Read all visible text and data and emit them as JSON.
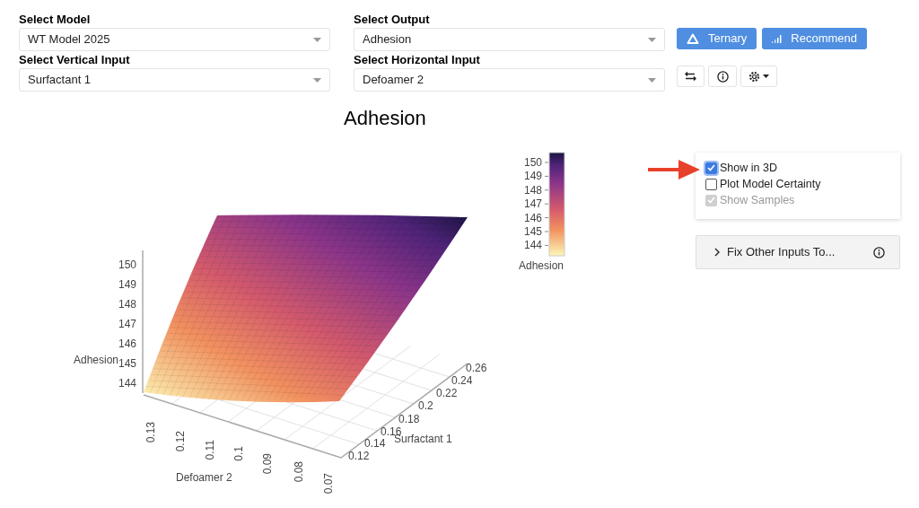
{
  "selects": [
    {
      "label": "Select Model",
      "value": "WT Model 2025"
    },
    {
      "label": "Select Output",
      "value": "Adhesion"
    },
    {
      "label": "Select Vertical Input",
      "value": "Surfactant 1"
    },
    {
      "label": "Select Horizontal Input",
      "value": "Defoamer 2"
    }
  ],
  "action_buttons": [
    {
      "label": "Ternary",
      "kind": "triangle"
    },
    {
      "label": "Recommend",
      "kind": "bars"
    }
  ],
  "tool_buttons": [
    {
      "kind": "swap"
    },
    {
      "kind": "info"
    },
    {
      "kind": "gear"
    }
  ],
  "plot": {
    "title": "Adhesion",
    "z_axis": {
      "title": "Adhesion",
      "ticks": [
        "150",
        "149",
        "148",
        "147",
        "146",
        "145",
        "144"
      ]
    },
    "x_axis": {
      "title": "Defoamer 2",
      "ticks": [
        "0.13",
        "0.12",
        "0.11",
        "0.1",
        "0.09",
        "0.08",
        "0.07"
      ]
    },
    "y_axis": {
      "title": "Surfactant 1",
      "ticks": [
        "0.12",
        "0.14",
        "0.16",
        "0.18",
        "0.2",
        "0.22",
        "0.24",
        "0.26"
      ]
    },
    "colorbar": {
      "title": "Adhesion",
      "ticks": [
        "150",
        "149",
        "148",
        "147",
        "146",
        "145",
        "144"
      ]
    }
  },
  "options": [
    {
      "label": "Show in 3D",
      "checked": true,
      "disabled": false
    },
    {
      "label": "Plot Model Certainty",
      "checked": false,
      "disabled": false
    },
    {
      "label": "Show Samples",
      "checked": true,
      "disabled": true
    }
  ],
  "expander": {
    "label": "Fix Other Inputs To...",
    "expanded": false
  }
}
